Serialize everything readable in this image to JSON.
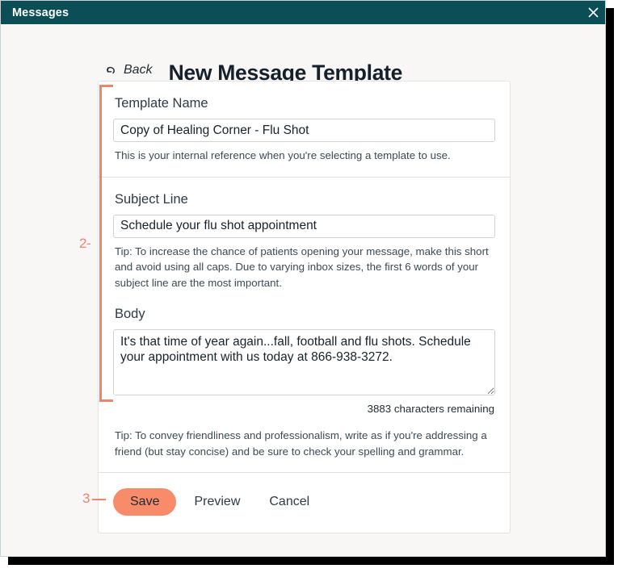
{
  "window": {
    "title": "Messages",
    "close_icon": "close-icon"
  },
  "header": {
    "back_label": "Back",
    "back_icon": "back-arrow-icon",
    "title": "New Message Template"
  },
  "form": {
    "template_name": {
      "label": "Template Name",
      "value": "Copy of Healing Corner - Flu Shot",
      "placeholder": "",
      "helper": "This is your internal reference when you're selecting a template to use."
    },
    "subject_line": {
      "label": "Subject Line",
      "value": "Schedule your flu shot appointment",
      "placeholder": "",
      "helper": "Tip: To increase the chance of patients opening your message, make this short and avoid using all caps. Due to varying inbox sizes, the first 6 words of your subject line are the most important."
    },
    "body": {
      "label": "Body",
      "value": "It's that time of year again...fall, football and flu shots. Schedule your appointment with us today at 866-938-3272.",
      "placeholder": "",
      "counter": "3883 characters remaining",
      "helper": "Tip: To convey friendliness and professionalism, write as if you're addressing a friend (but stay concise) and be sure to check your spelling and grammar."
    }
  },
  "actions": {
    "save_label": "Save",
    "preview_label": "Preview",
    "cancel_label": "Cancel"
  },
  "annotations": {
    "marker_two": "2-",
    "marker_three": "3"
  },
  "colors": {
    "titlebar": "#0B4E56",
    "accent": "#F78B6A",
    "annotation": "#F2836A",
    "page_bg": "#F8F7F5",
    "card_bg": "#FFFFFF"
  }
}
